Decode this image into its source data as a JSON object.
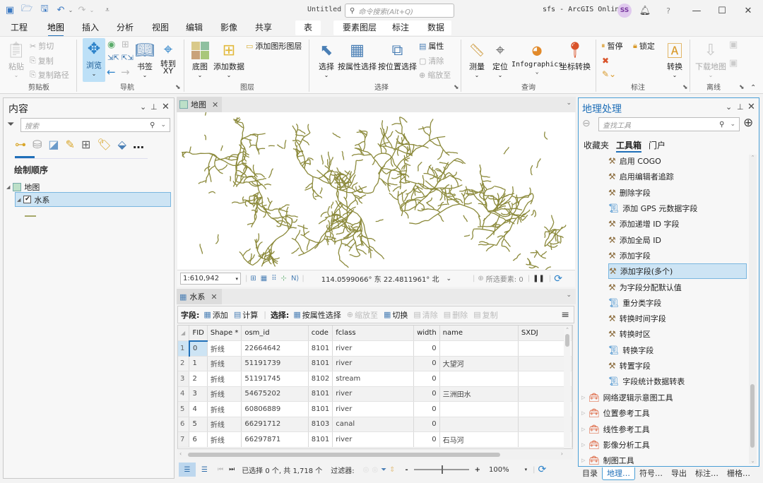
{
  "titlebar": {
    "quick_access": [
      {
        "icon": "new-project-icon"
      },
      {
        "icon": "open-project-icon"
      },
      {
        "icon": "save-project-icon"
      },
      {
        "icon": "undo-icon"
      },
      {
        "icon": "redo-icon"
      },
      {
        "icon": "customize-qat-icon"
      }
    ],
    "document_title": "Untitled",
    "command_search_placeholder": "命令搜索(Alt+Q)",
    "portal_label": "sfs - ArcGIS Online",
    "avatar_initials": "SS",
    "window_buttons": [
      "notifications",
      "help",
      "minimize",
      "maximize",
      "close"
    ]
  },
  "ribbon_tabs": [
    {
      "label": "工程"
    },
    {
      "label": "地图",
      "active": true
    },
    {
      "label": "插入"
    },
    {
      "label": "分析"
    },
    {
      "label": "视图"
    },
    {
      "label": "编辑"
    },
    {
      "label": "影像"
    },
    {
      "label": "共享"
    },
    {
      "label": "表"
    },
    {
      "label": "要素图层"
    },
    {
      "label": "标注"
    },
    {
      "label": "数据"
    }
  ],
  "ribbon": {
    "clipboard": {
      "label": "剪贴板",
      "paste": "粘贴",
      "cut": "剪切",
      "copy": "复制",
      "copy_path": "复制路径"
    },
    "navigate": {
      "label": "导航",
      "explore": "浏览",
      "bookmarks": "书签",
      "goto_xy": "转到\nXY"
    },
    "layer": {
      "label": "图层",
      "basemap": "底图",
      "add_data": "添加数据",
      "add_graphics_layer": "添加图形图层"
    },
    "selection": {
      "label": "选择",
      "select": "选择",
      "select_by_attr": "按属性选择",
      "select_by_loc": "按位置选择",
      "attributes": "属性",
      "clear": "清除",
      "zoom_to": "缩放至"
    },
    "inquiry": {
      "label": "查询",
      "measure": "测量",
      "locate": "定位",
      "infographics": "Infographics",
      "convert_coords": "坐标转换"
    },
    "labeling": {
      "label": "标注",
      "pause": "暂停",
      "lock": "锁定",
      "convert": "转换"
    },
    "offline": {
      "label": "离线",
      "download_map": "下载地图"
    }
  },
  "contents": {
    "title": "内容",
    "search_placeholder": "搜索",
    "section": "绘制顺序",
    "map_item": "地图",
    "layer_item": "水系",
    "layer_checked": true,
    "tool_icons": [
      "drawing-order-icon",
      "data-source-icon",
      "selection-icon",
      "editing-icon",
      "snapping-icon",
      "labeling-icon",
      "perspective-imagery-icon",
      "more-icon"
    ]
  },
  "map": {
    "tab_label": "地图",
    "scale": "1:610,942",
    "coordinates": "114.0599066° 东 22.4811961° 北",
    "selected_features": "所选要素: 0",
    "line_color": "#8c8a3c"
  },
  "attribute_table": {
    "tab_label": "水系",
    "toolbar": {
      "field_label": "字段:",
      "add": "添加",
      "calculate": "计算",
      "selection_label": "选择:",
      "select_by_attr": "按属性选择",
      "zoom_to": "缩放至",
      "switch": "切换",
      "clear": "清除",
      "delete": "删除",
      "copy": "复制"
    },
    "columns": [
      "FID",
      "Shape *",
      "osm_id",
      "code",
      "fclass",
      "width",
      "name",
      "SXDJ"
    ],
    "rows": [
      [
        "1",
        "0",
        "折线",
        "22664642",
        "8101",
        "river",
        "0",
        "",
        ""
      ],
      [
        "2",
        "1",
        "折线",
        "51191739",
        "8101",
        "river",
        "0",
        "大望河",
        ""
      ],
      [
        "3",
        "2",
        "折线",
        "51191745",
        "8102",
        "stream",
        "0",
        "",
        ""
      ],
      [
        "4",
        "3",
        "折线",
        "54675202",
        "8101",
        "river",
        "0",
        "三洲田水",
        ""
      ],
      [
        "5",
        "4",
        "折线",
        "60806889",
        "8101",
        "river",
        "0",
        "",
        ""
      ],
      [
        "6",
        "5",
        "折线",
        "66291712",
        "8103",
        "canal",
        "0",
        "",
        ""
      ],
      [
        "7",
        "6",
        "折线",
        "66297871",
        "8101",
        "river",
        "0",
        "石马河",
        ""
      ]
    ],
    "status": {
      "selection": "已选择 0 个, 共 1,718 个",
      "filter_label": "过滤器:",
      "zoom": "100%",
      "zoom_slider_fraction": 0.5
    }
  },
  "geoprocessing": {
    "title": "地理处理",
    "search_placeholder": "查找工具",
    "tabs": [
      {
        "label": "收藏夹"
      },
      {
        "label": "工具箱",
        "active": true
      },
      {
        "label": "门户"
      }
    ],
    "tools": [
      {
        "label": "启用 COGO",
        "icon": "hammer-icon"
      },
      {
        "label": "启用编辑者追踪",
        "icon": "hammer-icon"
      },
      {
        "label": "删除字段",
        "icon": "hammer-icon"
      },
      {
        "label": "添加 GPS 元数据字段",
        "icon": "script-icon"
      },
      {
        "label": "添加递增 ID 字段",
        "icon": "hammer-icon"
      },
      {
        "label": "添加全局 ID",
        "icon": "hammer-icon"
      },
      {
        "label": "添加字段",
        "icon": "hammer-icon"
      },
      {
        "label": "添加字段(多个)",
        "icon": "hammer-icon",
        "selected": true
      },
      {
        "label": "为字段分配默认值",
        "icon": "hammer-icon"
      },
      {
        "label": "重分类字段",
        "icon": "script-icon"
      },
      {
        "label": "转换时间字段",
        "icon": "hammer-icon"
      },
      {
        "label": "转换时区",
        "icon": "hammer-icon"
      },
      {
        "label": "转换字段",
        "icon": "script-icon"
      },
      {
        "label": "转置字段",
        "icon": "hammer-icon"
      },
      {
        "label": "字段统计数据转表",
        "icon": "script-icon"
      }
    ],
    "toolboxes": [
      {
        "label": "网络逻辑示意图工具"
      },
      {
        "label": "位置参考工具"
      },
      {
        "label": "线性参考工具"
      },
      {
        "label": "影像分析工具"
      },
      {
        "label": "制图工具"
      }
    ]
  },
  "bottom_tabs": [
    {
      "label": "目录"
    },
    {
      "label": "地理…",
      "active": true
    },
    {
      "label": "符号…"
    },
    {
      "label": "导出"
    },
    {
      "label": "标注…"
    },
    {
      "label": "栅格…"
    }
  ]
}
